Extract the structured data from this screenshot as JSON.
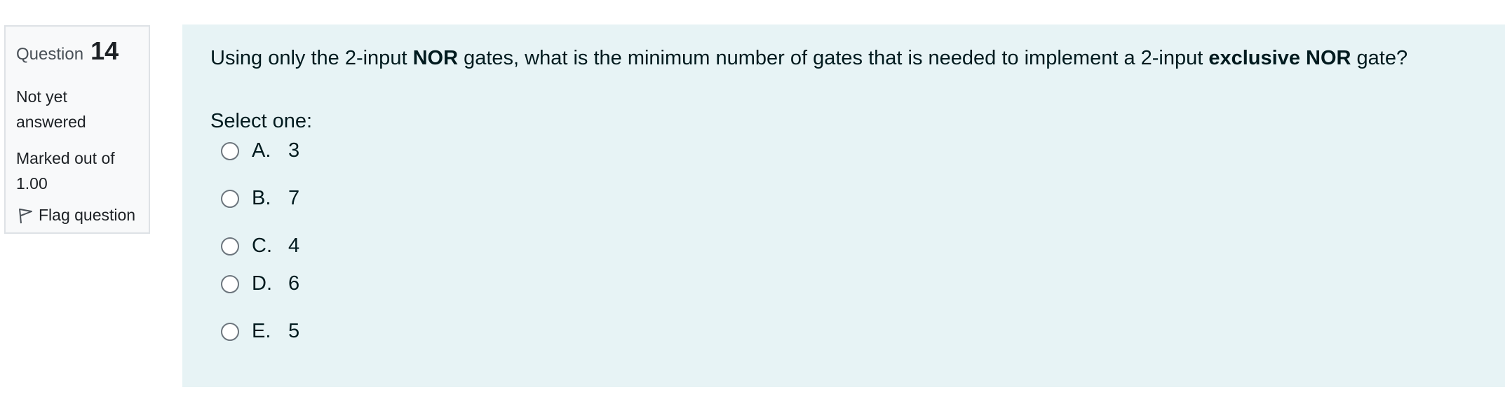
{
  "info": {
    "question_prefix": "Question",
    "question_number": "14",
    "state": "Not yet answered",
    "grade": "Marked out of 1.00",
    "flag_label": "Flag question",
    "flag_icon": "flag-outline-icon"
  },
  "question": {
    "text_parts": {
      "p1": "Using only the 2-input ",
      "b1": "NOR",
      "p2": " gates, what is the minimum number of gates that is needed to implement a 2-input ",
      "b2": "exclusive NOR",
      "p3": " gate?"
    },
    "prompt": "Select one:",
    "options": [
      {
        "letter": "A.",
        "value": "3"
      },
      {
        "letter": "B.",
        "value": "7"
      },
      {
        "letter": "C.",
        "value": "4"
      },
      {
        "letter": "D.",
        "value": "6"
      },
      {
        "letter": "E.",
        "value": "5"
      }
    ]
  },
  "colors": {
    "content_bg": "#e7f3f5",
    "info_bg": "#f8f9fa",
    "info_border": "#dee2e6",
    "text": "#001a1e"
  }
}
